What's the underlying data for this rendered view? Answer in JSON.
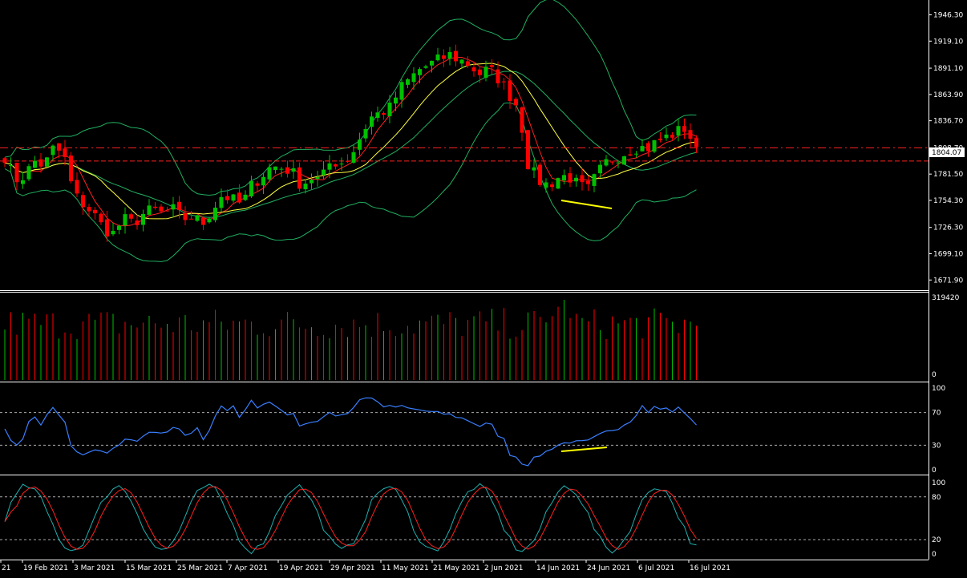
{
  "app": {
    "platform": "trading chart",
    "theme": {
      "background": "#000000",
      "foreground": "#ffffff",
      "separator": "#ffffff"
    }
  },
  "colors": {
    "bull": "#00c000",
    "bear": "#ff0000",
    "bollinger": "#20b060",
    "ma_fast": "#ff2020",
    "ma_slow": "#ffff40",
    "level_line": "#ff2020",
    "rsi": "#3a7fff",
    "stoch_main": "#20b0b0",
    "stoch_signal": "#ff2020",
    "trendline": "#ffff00",
    "guide": "#aaaaaa"
  },
  "price_axis": {
    "labels": [
      "1946.30",
      "1919.10",
      "1891.10",
      "1863.90",
      "1836.70",
      "1808.70",
      "1781.50",
      "1754.30",
      "1726.30",
      "1699.10",
      "1671.90"
    ],
    "current_price": "1804.07"
  },
  "volume_axis": {
    "max_label": "319420",
    "min_label": "0"
  },
  "rsi_axis": {
    "labels": [
      "100",
      "70",
      "30",
      "0"
    ]
  },
  "stoch_axis": {
    "labels": [
      "100",
      "80",
      "20",
      "0"
    ]
  },
  "time_axis": {
    "labels": [
      "21",
      "19 Feb 2021",
      "3 Mar 2021",
      "15 Mar 2021",
      "25 Mar 2021",
      "7 Apr 2021",
      "19 Apr 2021",
      "29 Apr 2021",
      "11 May 2021",
      "21 May 2021",
      "2 Jun 2021",
      "14 Jun 2021",
      "24 Jun 2021",
      "6 Jul 2021",
      "16 Jul 2021"
    ]
  },
  "chart_data": {
    "type": "candlestick",
    "symbol_period": "daily",
    "date_range": [
      "Feb 2021",
      "16 Jul 2021"
    ],
    "close_approx": [
      1800,
      1775,
      1780,
      1795,
      1790,
      1810,
      1800,
      1760,
      1750,
      1740,
      1725,
      1720,
      1735,
      1730,
      1740,
      1745,
      1740,
      1745,
      1735,
      1738,
      1730,
      1745,
      1760,
      1755,
      1750,
      1770,
      1780,
      1790,
      1788,
      1785,
      1770,
      1778,
      1775,
      1795,
      1793,
      1800,
      1820,
      1840,
      1845,
      1850,
      1870,
      1880,
      1890,
      1895,
      1900,
      1905,
      1900,
      1895,
      1885,
      1890,
      1880,
      1865,
      1850,
      1790,
      1775,
      1770,
      1778,
      1780,
      1770,
      1765,
      1782,
      1795,
      1800,
      1805,
      1810,
      1808,
      1815,
      1820,
      1825,
      1830,
      1804
    ],
    "overlays": [
      "Bollinger Bands",
      "Moving Average (fast)",
      "Moving Average (slow)"
    ],
    "horizontal_levels": [
      1808.7,
      1795.0
    ],
    "indicators": [
      "Volume",
      "RSI",
      "Stochastic"
    ]
  }
}
